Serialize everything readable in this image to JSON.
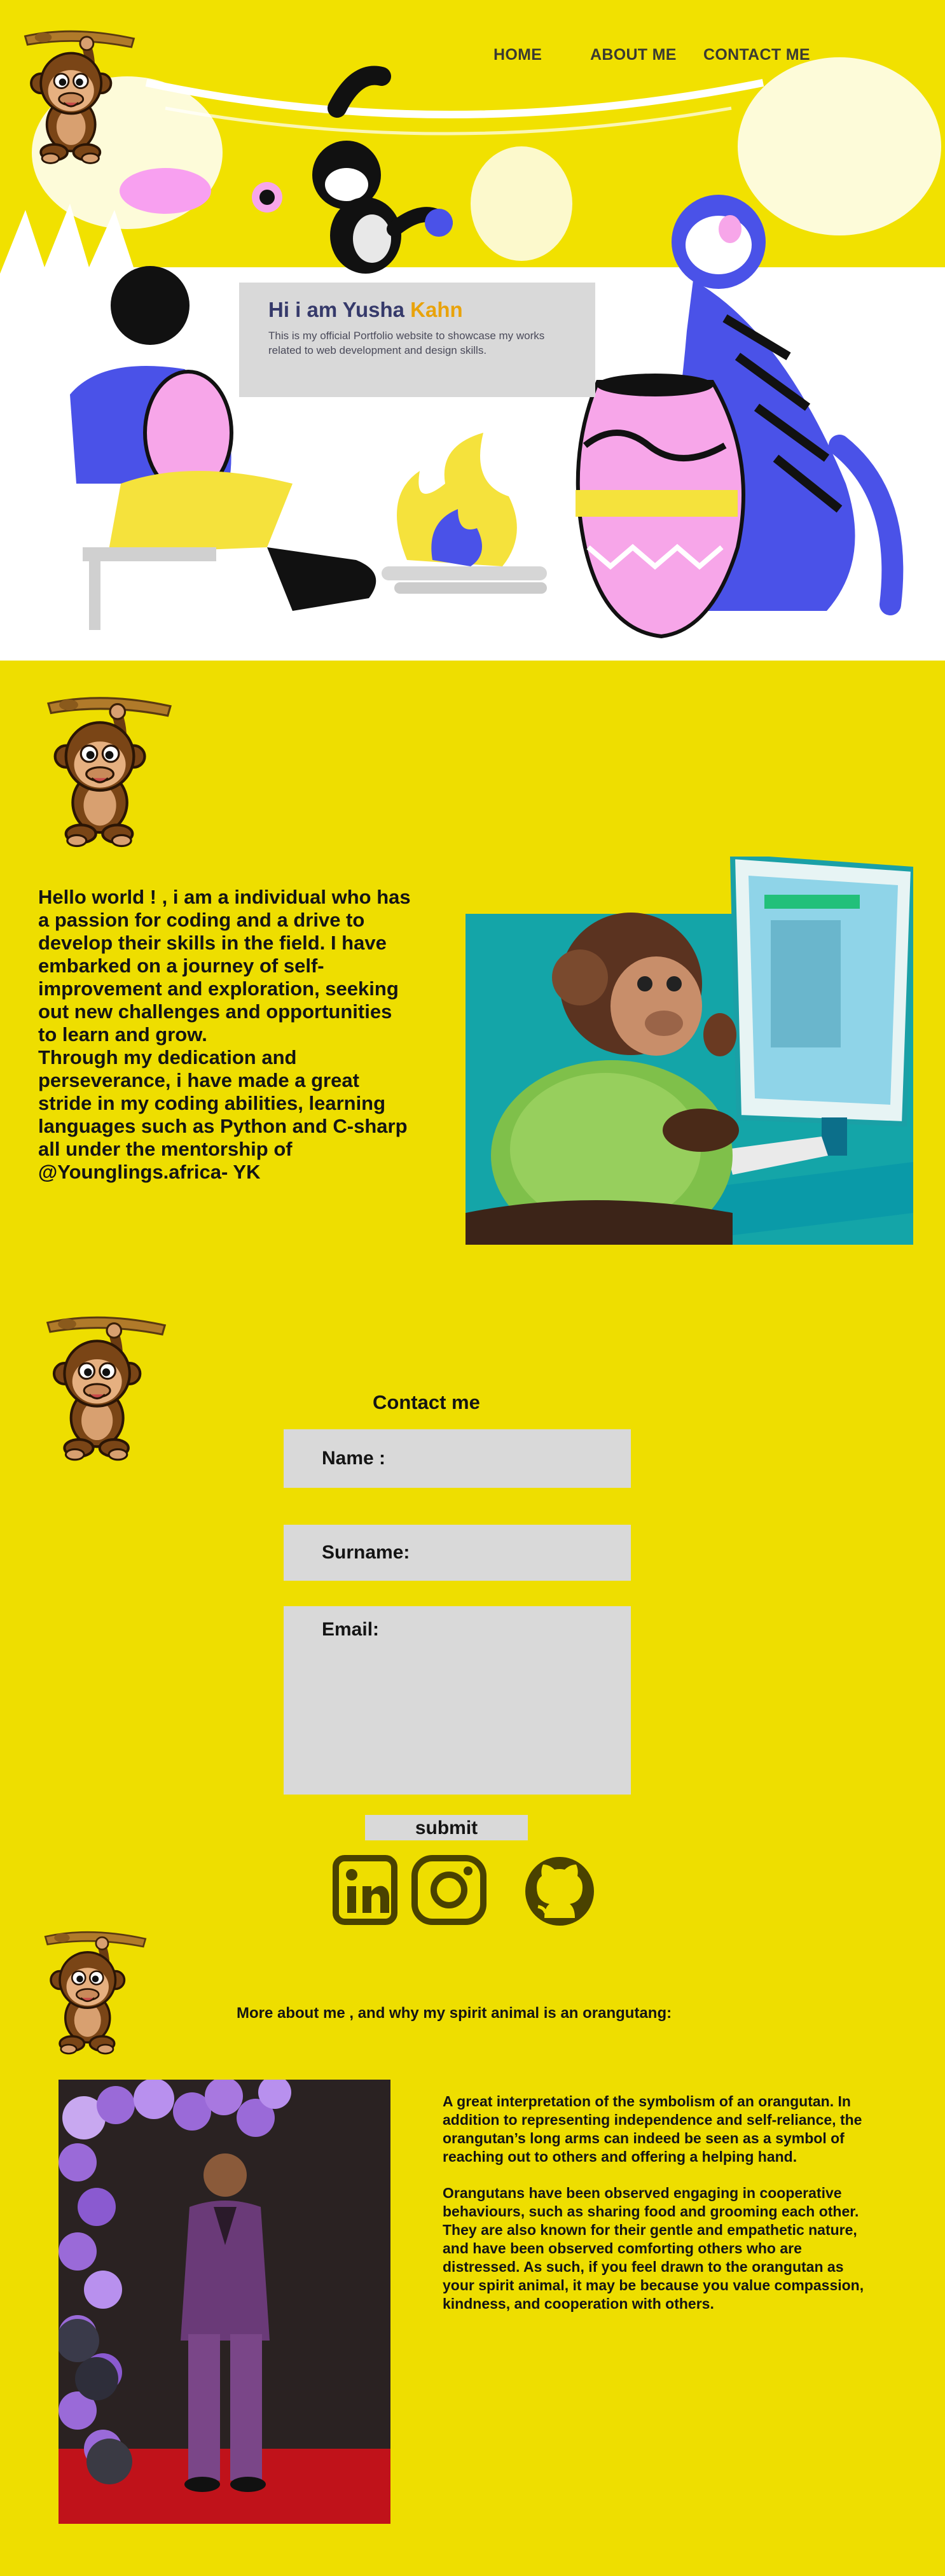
{
  "nav": {
    "home": "HOME",
    "about": "ABOUT ME",
    "contact": "CONTACT ME"
  },
  "intro": {
    "heading_prefix": "Hi i am Yusha ",
    "heading_highlight": "Kahn",
    "subtitle": "This is my official Portfolio website to showcase my works related to web development and design skills."
  },
  "about": {
    "text": "Hello world ! , i am a individual who has\na passion for coding and a drive to\ndevelop their skills in the field. I have\nembarked on a journey of self-\nimprovement and exploration, seeking\nout new challenges and opportunities\nto learn and grow.\nThrough my dedication and\nperseverance, i have made a great\nstride in my  coding abilities, learning\nlanguages such as Python and C-sharp\nall under the mentorship of\n@Younglings.africa- YK"
  },
  "contact": {
    "title": "Contact me",
    "name_label": "Name :",
    "surname_label": "Surname:",
    "email_label": "Email:",
    "submit_label": "submit"
  },
  "social": {
    "icons": [
      "linkedin-icon",
      "instagram-icon",
      "github-icon"
    ]
  },
  "more": {
    "heading": "More about me , and why my spirit animal is an orangutang:",
    "paragraph1": "A great interpretation of the symbolism of an orangutan. In addition to representing independence and self-reliance, the orangutan’s long arms can indeed be seen as a symbol of reaching out to others and offering a helping hand.",
    "paragraph2": "Orangutans have been observed engaging in cooperative behaviours, such as sharing food and grooming each other. They are also known for their gentle and empathetic nature, and have been observed comforting others who are distressed. As such, if you feel drawn to the orangutan as your spirit animal, it may be because you value compassion, kindness, and cooperation with others."
  },
  "colors": {
    "page_bg": "#eede00",
    "card_bg": "#d9d9d9",
    "heading_navy": "#363a6b",
    "highlight_orange": "#e9a30b",
    "icon_dark": "#4a4200"
  }
}
